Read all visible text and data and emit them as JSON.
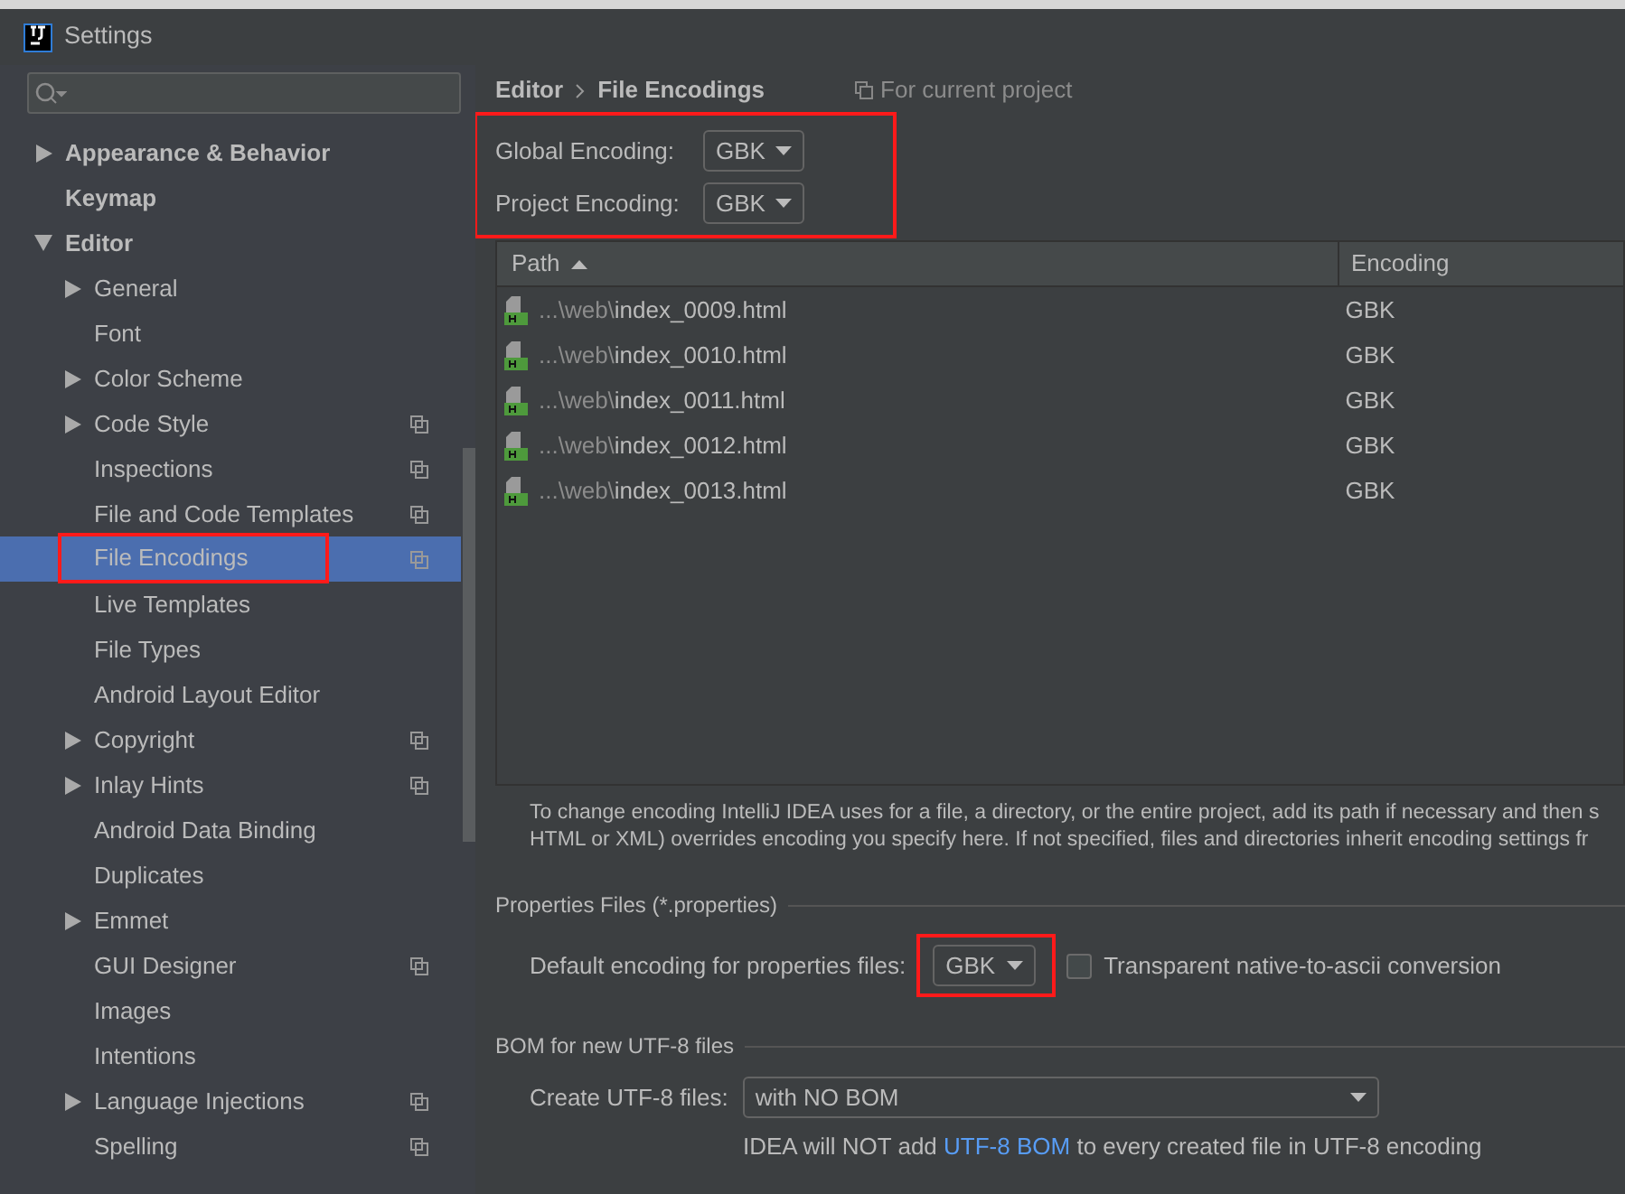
{
  "window": {
    "title": "Settings"
  },
  "sidebar": {
    "items": [
      {
        "label": "Appearance & Behavior",
        "expanded": false,
        "project_scope": false,
        "selected": false,
        "highlighted": false
      },
      {
        "label": "Keymap",
        "project_scope": false,
        "selected": false,
        "highlighted": false
      },
      {
        "label": "Editor",
        "expanded": true,
        "project_scope": false,
        "selected": false,
        "highlighted": false,
        "children": [
          {
            "label": "General",
            "expanded": false,
            "project_scope": false,
            "selected": false,
            "highlighted": false
          },
          {
            "label": "Font",
            "project_scope": false,
            "selected": false,
            "highlighted": false
          },
          {
            "label": "Color Scheme",
            "expanded": false,
            "project_scope": false,
            "selected": false,
            "highlighted": false
          },
          {
            "label": "Code Style",
            "expanded": false,
            "project_scope": true,
            "selected": false,
            "highlighted": false
          },
          {
            "label": "Inspections",
            "project_scope": true,
            "selected": false,
            "highlighted": false
          },
          {
            "label": "File and Code Templates",
            "project_scope": true,
            "selected": false,
            "highlighted": false
          },
          {
            "label": "File Encodings",
            "project_scope": true,
            "selected": true,
            "highlighted": true
          },
          {
            "label": "Live Templates",
            "project_scope": false,
            "selected": false,
            "highlighted": false
          },
          {
            "label": "File Types",
            "project_scope": false,
            "selected": false,
            "highlighted": false
          },
          {
            "label": "Android Layout Editor",
            "project_scope": false,
            "selected": false,
            "highlighted": false
          },
          {
            "label": "Copyright",
            "expanded": false,
            "project_scope": true,
            "selected": false,
            "highlighted": false
          },
          {
            "label": "Inlay Hints",
            "expanded": false,
            "project_scope": true,
            "selected": false,
            "highlighted": false
          },
          {
            "label": "Android Data Binding",
            "project_scope": false,
            "selected": false,
            "highlighted": false
          },
          {
            "label": "Duplicates",
            "project_scope": false,
            "selected": false,
            "highlighted": false
          },
          {
            "label": "Emmet",
            "expanded": false,
            "project_scope": false,
            "selected": false,
            "highlighted": false
          },
          {
            "label": "GUI Designer",
            "project_scope": true,
            "selected": false,
            "highlighted": false
          },
          {
            "label": "Images",
            "project_scope": false,
            "selected": false,
            "highlighted": false
          },
          {
            "label": "Intentions",
            "project_scope": false,
            "selected": false,
            "highlighted": false
          },
          {
            "label": "Language Injections",
            "expanded": false,
            "project_scope": true,
            "selected": false,
            "highlighted": false
          },
          {
            "label": "Spelling",
            "project_scope": true,
            "selected": false,
            "highlighted": false
          }
        ]
      }
    ]
  },
  "breadcrumb": [
    "Editor",
    "File Encodings"
  ],
  "scope_note": "For current project",
  "encodings": {
    "highlighted": true,
    "rows": [
      {
        "label": "Global Encoding:",
        "value": "GBK"
      },
      {
        "label": "Project Encoding:",
        "value": "GBK"
      }
    ]
  },
  "table": {
    "columns": [
      "Path",
      "Encoding"
    ],
    "rows": [
      {
        "prefix": "...\\web\\",
        "file": "index_0009.html",
        "encoding": "GBK"
      },
      {
        "prefix": "...\\web\\",
        "file": "index_0010.html",
        "encoding": "GBK"
      },
      {
        "prefix": "...\\web\\",
        "file": "index_0011.html",
        "encoding": "GBK"
      },
      {
        "prefix": "...\\web\\",
        "file": "index_0012.html",
        "encoding": "GBK"
      },
      {
        "prefix": "...\\web\\",
        "file": "index_0013.html",
        "encoding": "GBK"
      }
    ]
  },
  "description": [
    "To change encoding IntelliJ IDEA uses for a file, a directory, or the entire project, add its path if necessary and then s",
    "HTML or XML) overrides encoding you specify here. If not specified, files and directories inherit encoding settings fr"
  ],
  "properties": {
    "title": "Properties Files (*.properties)",
    "label": "Default encoding for properties files:",
    "value": "GBK",
    "highlighted": true,
    "checkbox": {
      "label": "Transparent native-to-ascii conversion",
      "checked": false
    }
  },
  "bom": {
    "title": "BOM for new UTF-8 files",
    "label": "Create UTF-8 files:",
    "value": "with NO BOM",
    "note_before": "IDEA will NOT add ",
    "note_link": "UTF-8 BOM",
    "note_after": " to every created file in UTF-8 encoding"
  }
}
